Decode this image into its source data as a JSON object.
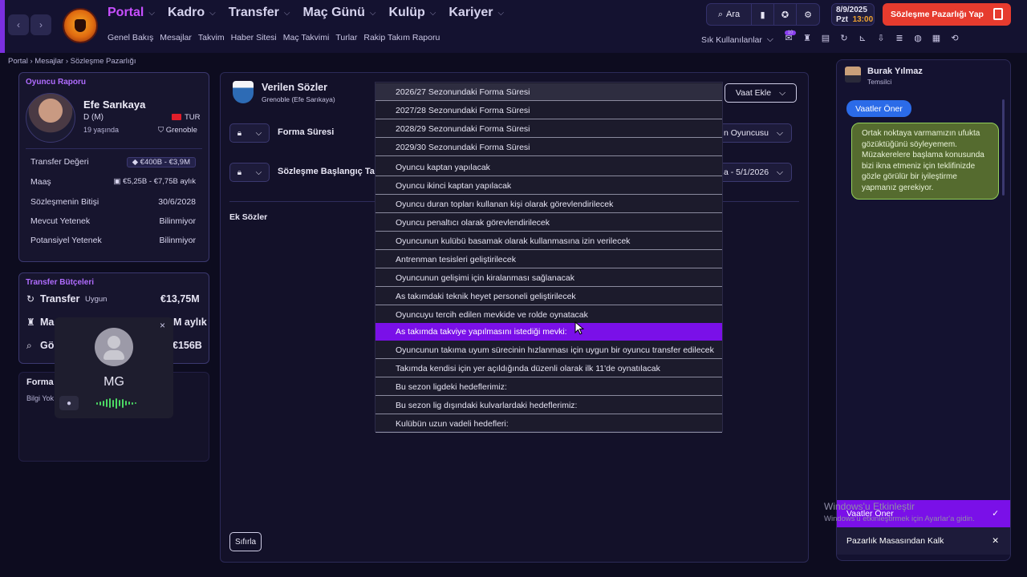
{
  "top_nav": {
    "back_icon": "chevron-left-icon",
    "forward_icon": "chevron-right-icon",
    "menu": [
      {
        "label": "Portal",
        "active": true
      },
      {
        "label": "Kadro"
      },
      {
        "label": "Transfer"
      },
      {
        "label": "Maç Günü"
      },
      {
        "label": "Kulüp"
      },
      {
        "label": "Kariyer"
      }
    ],
    "submenu": [
      "Genel Bakış",
      "Mesajlar",
      "Takvim",
      "Haber Sitesi",
      "Maç Takvimi",
      "Turlar",
      "Rakip Takım Raporu"
    ],
    "search_label": "Ara",
    "date": "8/9/2025",
    "day": "Pzt",
    "time": "13:00",
    "cta_label": "Sözleşme Pazarlığı Yap",
    "frequent_label": "Sık Kullanılanlar",
    "notification_count": "10"
  },
  "breadcrumb": [
    "Portal",
    "Mesajlar",
    "Sözleşme Pazarlığı"
  ],
  "player_report": {
    "title": "Oyuncu Raporu",
    "name": "Efe Sarıkaya",
    "position": "D (M)",
    "age": "19 yaşında",
    "nation": "TUR",
    "club": "Grenoble",
    "rows": [
      {
        "label": "Transfer Değeri",
        "value": "€400B - €3,9M"
      },
      {
        "label": "Maaş",
        "value": "€5,25B - €7,75B aylık"
      },
      {
        "label": "Sözleşmenin Bitişi",
        "value": "30/6/2028"
      },
      {
        "label": "Mevcut Yetenek",
        "value": "Bilinmiyor"
      },
      {
        "label": "Potansiyel Yetenek",
        "value": "Bilinmiyor"
      }
    ]
  },
  "budgets": {
    "title": "Transfer Bütçeleri",
    "transfer_label": "Transfer",
    "transfer_status": "Uygun",
    "transfer_value": "€13,75M",
    "wage_label_partial": "Ma",
    "wage_value_partial": "M aylık",
    "third_label_partial": "Gö",
    "third_value_partial": "€156B"
  },
  "form_panel": {
    "title_partial": "Forma",
    "text_partial": "Bilgi Yok"
  },
  "call_widget": {
    "initials": "MG"
  },
  "promises": {
    "title": "Verilen Sözler",
    "subtitle": "Grenoble  (Efe Sarıkaya)",
    "add_button": "Vaat Ekle",
    "row1_label": "Forma Süresi",
    "row1_value": "n Oyuncusu",
    "row2_label": "Sözleşme Başlangıç Tar",
    "row2_value": "a - 5/1/2026",
    "extra_title": "Ek Sözler",
    "reset_button": "Sıfırla"
  },
  "dropdown": {
    "items": [
      "2026/27 Sezonundaki Forma Süresi",
      "2027/28 Sezonundaki Forma Süresi",
      "2028/29 Sezonundaki Forma Süresi",
      "2029/30 Sezonundaki Forma Süresi",
      "Oyuncu kaptan yapılacak",
      "Oyuncu ikinci kaptan yapılacak",
      "Oyuncu duran topları kullanan kişi olarak görevlendirilecek",
      "Oyuncu penaltıcı olarak görevlendirilecek",
      "Oyuncunun kulübü basamak olarak kullanmasına izin verilecek",
      "Antrenman tesisleri geliştirilecek",
      "Oyuncunun gelişimi için kiralanması sağlanacak",
      "As takımdaki teknik heyet personeli geliştirilecek",
      "Oyuncuyu tercih edilen mevkide ve rolde oynatacak",
      "As takımda takviye yapılmasını istediği mevki:",
      "Oyuncunun takıma uyum sürecinin hızlanması için uygun bir oyuncu transfer edilecek",
      "Takımda kendisi için yer açıldığında düzenli olarak ilk 11'de oynatılacak",
      "Bu sezon ligdeki hedeflerimiz:",
      "Bu sezon lig dışındaki kulvarlardaki hedeflerimiz:",
      "Kulübün uzun vadeli hedefleri:"
    ],
    "highlighted_index": 13
  },
  "chat": {
    "agent_name": "Burak Yılmaz",
    "agent_role": "Temsilci",
    "user_bubble": "Vaatler Öner",
    "agent_bubble": "Ortak noktaya varmamızın ufukta gözüktüğünü söyleyemem. Müzakerelere başlama konusunda bizi ikna etmeniz için teklifinizde gözle görülür bir iyileştirme yapmanız gerekiyor.",
    "action_primary": "Vaatler Öner",
    "action_secondary": "Pazarlık Masasından Kalk"
  },
  "watermark": {
    "line1": "Windows'u Etkinleştir",
    "line2": "Windows'u etkinleştirmek için Ayarlar'a gidin."
  },
  "colors": {
    "accent_purple": "#7a10e8",
    "cta_red": "#e63b2e",
    "chat_blue": "#2b6be8",
    "chat_green": "#556b2f"
  }
}
